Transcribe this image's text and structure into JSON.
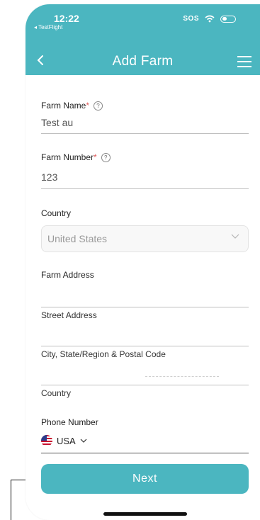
{
  "status_bar": {
    "time": "12:22",
    "back_app": "◂ TestFlight",
    "sos": "SOS"
  },
  "nav": {
    "title": "Add Farm"
  },
  "form": {
    "farm_name": {
      "label": "Farm Name",
      "required": "*",
      "value": "Test au"
    },
    "farm_number": {
      "label": "Farm Number",
      "required": "*",
      "value": "123"
    },
    "country": {
      "label": "Country",
      "value": "United States"
    },
    "farm_address": {
      "label": "Farm Address",
      "street_label": "Street Address",
      "city_label": "City, State/Region & Postal Code",
      "country_label": "Country"
    },
    "phone": {
      "label": "Phone Number",
      "country_code": "USA"
    }
  },
  "next_button": {
    "label": "Next"
  },
  "colors": {
    "accent": "#4bb6c0",
    "required": "#e05a5a"
  }
}
